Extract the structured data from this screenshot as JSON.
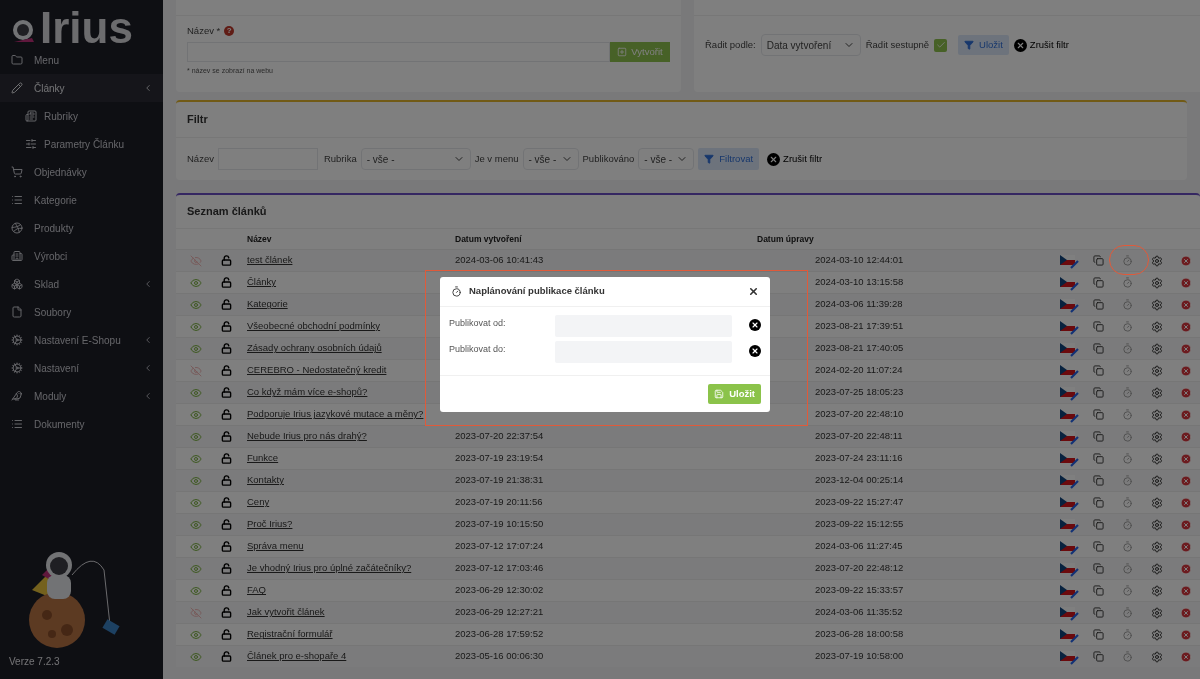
{
  "sidebar": {
    "logo": "Irius",
    "items": [
      {
        "label": "Menu",
        "selected": false,
        "expandable": false
      },
      {
        "label": "Články",
        "selected": true,
        "expandable": true,
        "children": [
          {
            "label": "Rubriky",
            "selected": false
          },
          {
            "label": "Parametry Článku",
            "selected": false
          }
        ]
      },
      {
        "label": "Objednávky",
        "selected": false,
        "expandable": false
      },
      {
        "label": "Kategorie",
        "selected": false,
        "expandable": false
      },
      {
        "label": "Produkty",
        "selected": false,
        "expandable": false
      },
      {
        "label": "Výrobci",
        "selected": false,
        "expandable": false
      },
      {
        "label": "Sklad",
        "selected": false,
        "expandable": true
      },
      {
        "label": "Soubory",
        "selected": false,
        "expandable": false
      },
      {
        "label": "Nastavení E-Shopu",
        "selected": false,
        "expandable": true
      },
      {
        "label": "Nastavení",
        "selected": false,
        "expandable": true
      },
      {
        "label": "Moduly",
        "selected": false,
        "expandable": true
      },
      {
        "label": "Dokumenty",
        "selected": false,
        "expandable": false
      }
    ],
    "version": "Verze 7.2.3"
  },
  "create_card": {
    "label": "Název *",
    "help_mark": "?",
    "hint": "* název se zobrazí na webu",
    "button": "Vytvořit"
  },
  "sort_card": {
    "sort_by_label": "Řadit podle:",
    "sort_by_value": "Data vytvoření",
    "descending_label": "Řadit sestupně",
    "descending_checked": true,
    "save_button": "Uložit",
    "clear_button": "Zrušit filtr"
  },
  "filter_card": {
    "title": "Filtr",
    "name_label": "Název",
    "category_label": "Rubrika",
    "category_value": "- vše -",
    "in_menu_label": "Je v menu",
    "in_menu_value": "- vše -",
    "published_label": "Publikováno",
    "published_value": "- vše -",
    "filter_button": "Filtrovat",
    "clear_button": "Zrušit filtr"
  },
  "table": {
    "title": "Seznam článků",
    "columns": [
      "Název",
      "Datum vytvoření",
      "Datum úpravy"
    ],
    "rows": [
      {
        "name": "test článek",
        "visible": false,
        "created": "2024-03-06 10:41:43",
        "modified": "2024-03-10 12:44:01"
      },
      {
        "name": "Články",
        "visible": true,
        "modified": "2024-03-10 13:15:58"
      },
      {
        "name": "Kategorie",
        "visible": true,
        "modified": "2024-03-06 11:39:28"
      },
      {
        "name": "Všeobecné obchodní podmínky",
        "visible": true,
        "modified": "2023-08-21 17:39:51"
      },
      {
        "name": "Zásady ochrany osobních údajů",
        "visible": true,
        "modified": "2023-08-21 17:40:05"
      },
      {
        "name": "CEREBRO - Nedostatečný kredit",
        "visible": false,
        "modified": "2024-02-20 11:07:24"
      },
      {
        "name": "Co když mám více e-shopů?",
        "visible": true,
        "modified": "2023-07-25 18:05:23"
      },
      {
        "name": "Podporuje Irius jazykové mutace a měny?",
        "visible": true,
        "modified": "2023-07-20 22:48:10"
      },
      {
        "name": "Nebude Irius pro nás drahý?",
        "visible": true,
        "created": "2023-07-20 22:37:54",
        "modified": "2023-07-20 22:48:11"
      },
      {
        "name": "Funkce",
        "visible": true,
        "created": "2023-07-19 23:19:54",
        "modified": "2023-07-24 23:11:16"
      },
      {
        "name": "Kontakty",
        "visible": true,
        "created": "2023-07-19 21:38:31",
        "modified": "2023-12-04 00:25:14"
      },
      {
        "name": "Ceny",
        "visible": true,
        "created": "2023-07-19 20:11:56",
        "modified": "2023-09-22 15:27:47"
      },
      {
        "name": "Proč Irius?",
        "visible": true,
        "created": "2023-07-19 10:15:50",
        "modified": "2023-09-22 15:12:55"
      },
      {
        "name": "Správa menu",
        "visible": true,
        "created": "2023-07-12 17:07:24",
        "modified": "2024-03-06 11:27:45"
      },
      {
        "name": "Je vhodný Irius pro úplné začátečníky?",
        "visible": true,
        "created": "2023-07-12 17:03:46",
        "modified": "2023-07-20 22:48:12"
      },
      {
        "name": "FAQ",
        "visible": true,
        "created": "2023-06-29 12:30:02",
        "modified": "2023-09-22 15:33:57"
      },
      {
        "name": "Jak vytvořit článek",
        "visible": false,
        "created": "2023-06-29 12:27:21",
        "modified": "2024-03-06 11:35:52"
      },
      {
        "name": "Registrační formulář",
        "visible": true,
        "created": "2023-06-28 17:59:52",
        "modified": "2023-06-28 18:00:58"
      },
      {
        "name": "Článek pro e-shopaře 4",
        "visible": true,
        "created": "2023-05-16 00:06:30",
        "modified": "2023-07-19 10:58:00"
      }
    ]
  },
  "annotations": {
    "frame": true,
    "circle": true
  },
  "modal": {
    "title": "Naplánování publikace článku",
    "fields": [
      {
        "label": "Publikovat od:"
      },
      {
        "label": "Publikovat do:"
      }
    ],
    "save_button": "Uložit"
  }
}
